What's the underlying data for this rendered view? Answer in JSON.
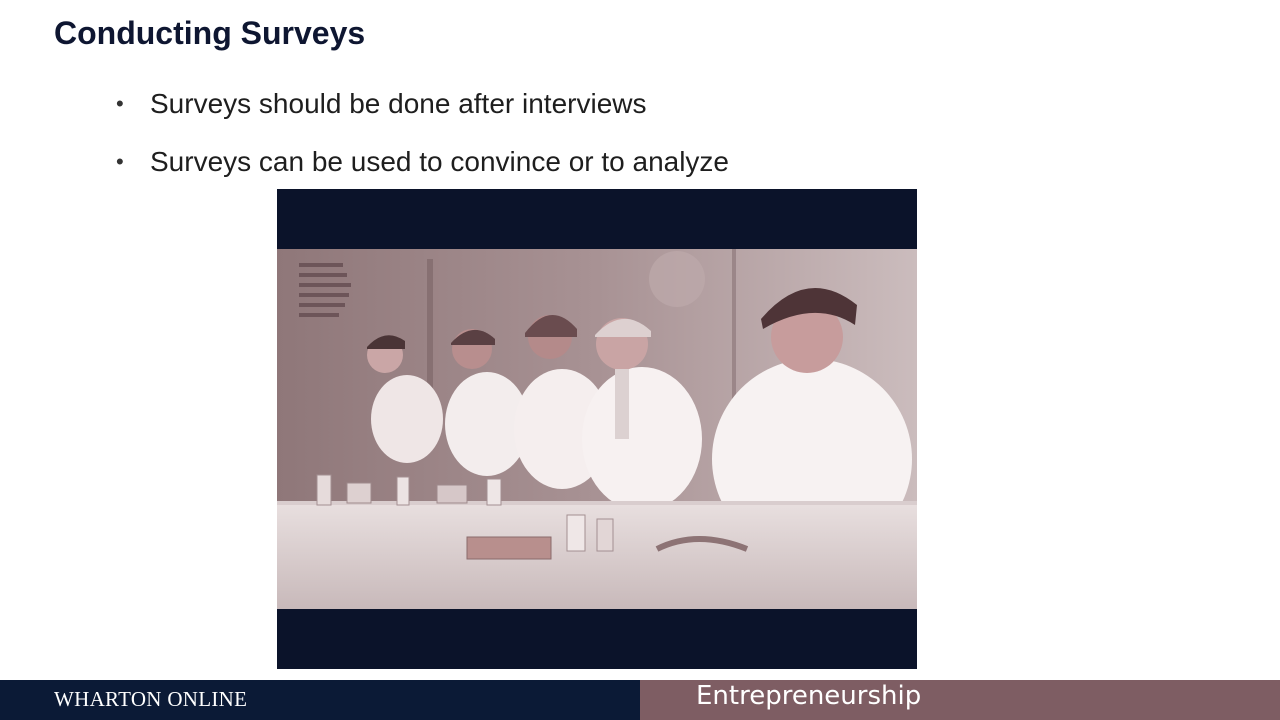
{
  "slide": {
    "title": "Conducting Surveys",
    "bullets": [
      "Surveys should be done after interviews",
      "Surveys can be used to convince or to analyze"
    ],
    "bullet_symbol": "•"
  },
  "footer": {
    "brand": "WHARTON ONLINE",
    "course": "Entrepreneurship"
  },
  "colors": {
    "title": "#0e1631",
    "footer_left_bg": "#0b1a36",
    "footer_right_bg": "#7e5d63",
    "video_letterbox": "#0b132a"
  }
}
